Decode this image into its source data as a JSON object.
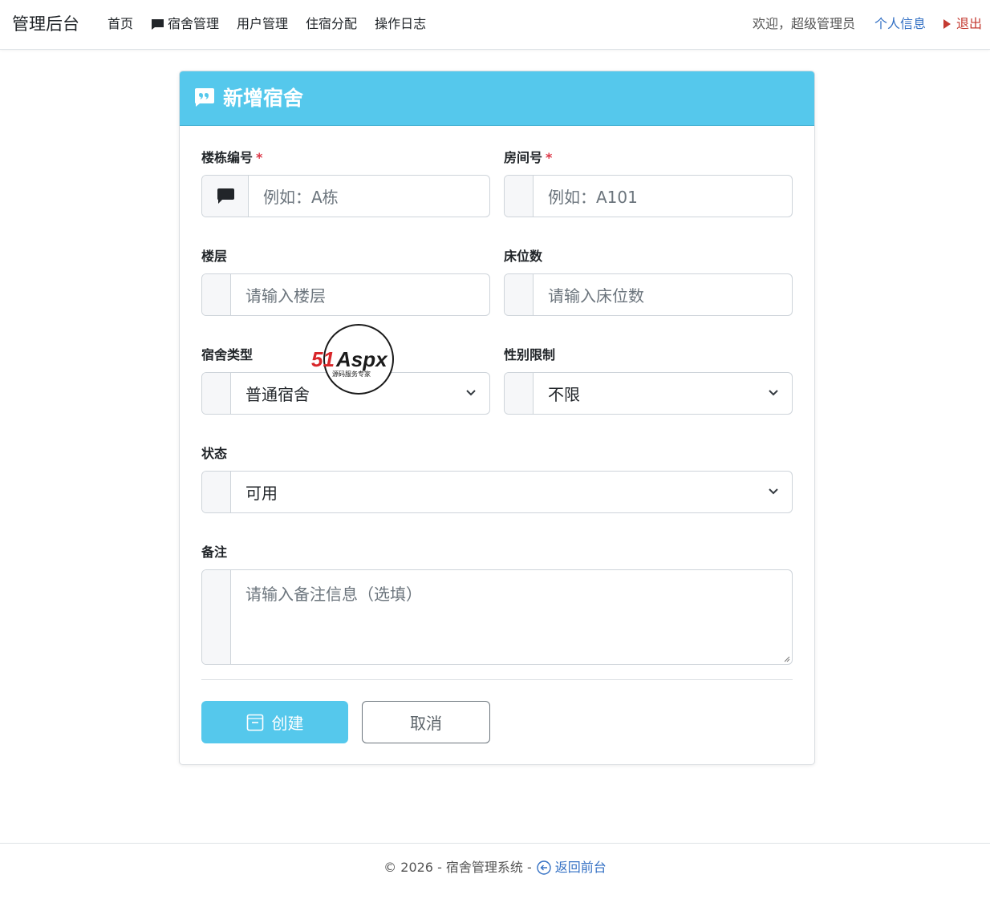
{
  "nav": {
    "brand": "管理后台",
    "links": [
      {
        "label": "首页"
      },
      {
        "label": "宿舍管理"
      },
      {
        "label": "用户管理"
      },
      {
        "label": "住宿分配"
      },
      {
        "label": "操作日志"
      }
    ],
    "welcome": "欢迎，超级管理员",
    "profile": "个人信息",
    "logout": "退出"
  },
  "card": {
    "title": "新增宿舍"
  },
  "form": {
    "building": {
      "label": "楼栋编号",
      "required_mark": "*",
      "placeholder": "例如：A栋"
    },
    "room": {
      "label": "房间号",
      "required_mark": "*",
      "placeholder": "例如：A101"
    },
    "floor": {
      "label": "楼层",
      "placeholder": "请输入楼层"
    },
    "beds": {
      "label": "床位数",
      "placeholder": "请输入床位数"
    },
    "type": {
      "label": "宿舍类型",
      "value": "普通宿舍"
    },
    "gender": {
      "label": "性别限制",
      "value": "不限"
    },
    "status": {
      "label": "状态",
      "value": "可用"
    },
    "remark": {
      "label": "备注",
      "placeholder": "请输入备注信息（选填）"
    }
  },
  "buttons": {
    "create": "创建",
    "cancel": "取消"
  },
  "footer": {
    "copyright": "© 2026 - 宿舍管理系统 -",
    "back": "返回前台"
  },
  "watermark": {
    "brand": "51Aspx",
    "tagline": "源码服务专家"
  },
  "colors": {
    "primary": "#55c8ec",
    "link": "#3370c4",
    "danger": "#c43a31",
    "required": "#dc3545"
  },
  "icons": [
    "chat-icon",
    "quote-icon",
    "chevron-down-icon",
    "save-icon",
    "back-arrow-icon",
    "caret-right-icon"
  ]
}
